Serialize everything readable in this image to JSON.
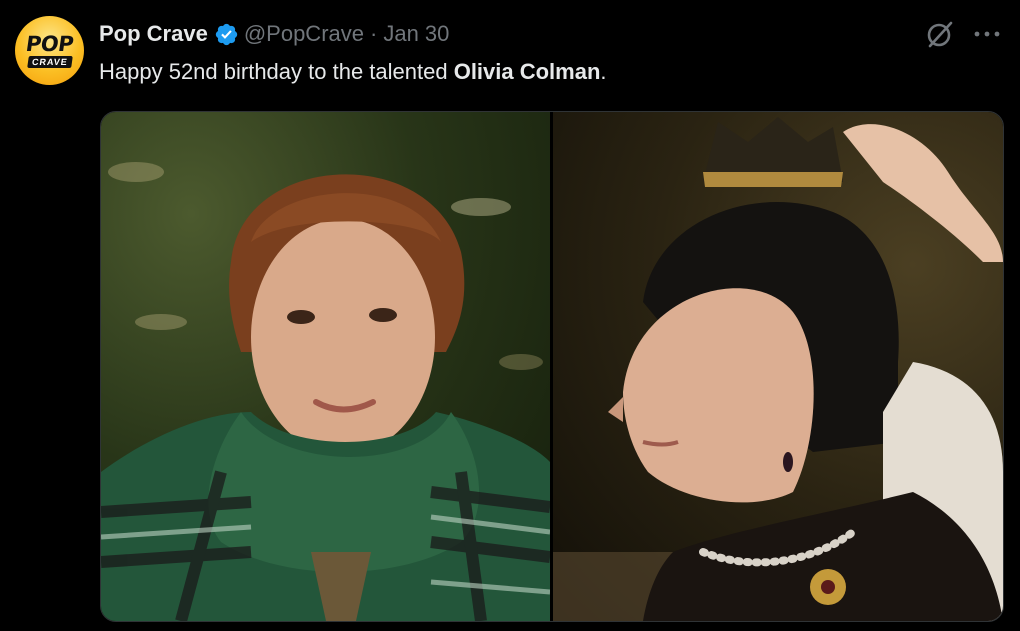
{
  "account": {
    "avatar_text_top": "POP",
    "avatar_text_bottom": "CRAVE",
    "name": "Pop Crave",
    "handle": "@PopCrave",
    "separator": "·",
    "date": "Jan 30",
    "verified_icon": "verified-badge-icon"
  },
  "post": {
    "text_before": "Happy 52nd birthday to the talented ",
    "text_bold": "Olivia Colman",
    "text_after": "."
  },
  "actions": {
    "grok_icon": "grok-icon",
    "more_icon": "more-horizontal-icon"
  },
  "media": {
    "image_count": 2,
    "left_image": "portrait-green-scarf",
    "right_image": "queen-crown-profile"
  },
  "colors": {
    "background": "#000000",
    "primary_text": "#e7e9ea",
    "secondary_text": "#71767b",
    "verified_blue": "#1d9bf0",
    "border": "#2f3336"
  }
}
